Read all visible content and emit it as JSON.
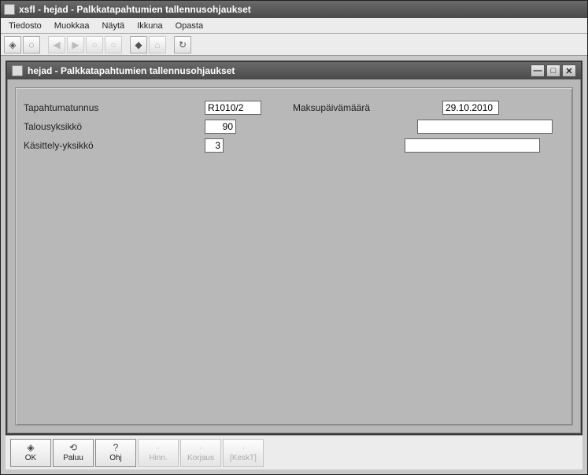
{
  "outer": {
    "title": "xsfl - hejad - Palkkatapahtumien tallennusohjaukset"
  },
  "menu": {
    "file": "Tiedosto",
    "edit": "Muokkaa",
    "view": "Näytä",
    "window": "Ikkuna",
    "help": "Opasta"
  },
  "inner": {
    "title": "hejad - Palkkatapahtumien tallennusohjaukset"
  },
  "form": {
    "labels": {
      "tapahtumatunnus": "Tapahtumatunnus",
      "talousyksikko": "Talousyksikkö",
      "kasittely": "Käsittely-yksikkö",
      "maksupaiva": "Maksupäivämäärä"
    },
    "values": {
      "tapahtumatunnus": "R1010/2",
      "talousyksikko": "90",
      "kasittely": "3",
      "maksupaiva": "29.10.2010",
      "extra1": "",
      "extra2": ""
    }
  },
  "buttons": {
    "ok": "OK",
    "paluu": "Paluu",
    "ohj": "Ohj",
    "hinn": "Hinn.",
    "korjaus": "Korjaus",
    "keskt": "[KeskT]"
  }
}
